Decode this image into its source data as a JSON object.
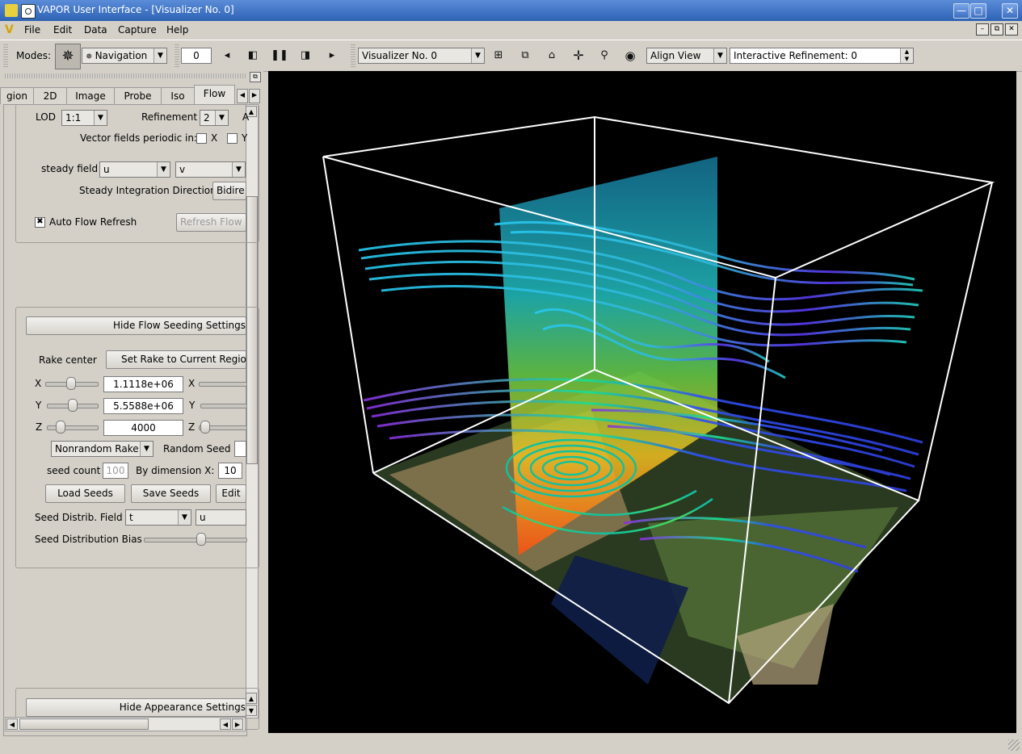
{
  "window": {
    "title": "VAPOR User Interface - [Visualizer No. 0]",
    "min_glyph": "—",
    "max_glyph": "□",
    "close_glyph": "✕"
  },
  "menu": {
    "items": [
      "File",
      "Edit",
      "Data",
      "Capture",
      "Help"
    ],
    "mdi_min": "–",
    "mdi_restore": "⧉",
    "mdi_close": "✕"
  },
  "toolbar": {
    "modes_label": "Modes:",
    "mode_value": "Navigation",
    "frame_value": "0",
    "visualizer_value": "Visualizer No. 0",
    "align_view_value": "Align View",
    "refinement_value": "Interactive Refinement: 0"
  },
  "tabs": [
    "gion",
    "2D",
    "Image",
    "Probe",
    "Iso",
    "Flow"
  ],
  "flow_panel": {
    "lod_label": "LOD",
    "lod_value": "1:1",
    "refinement_label": "Refinement",
    "refinement_value": "2",
    "refinement_trailing": "A",
    "periodic_label": "Vector fields periodic in:",
    "periodic_x": "X",
    "periodic_y": "Y",
    "steady_field_label": "steady field",
    "steady_field_1": "u",
    "steady_field_2": "v",
    "direction_label": "Steady Integration Direction",
    "direction_value": "Bidire",
    "auto_refresh_label": "Auto Flow Refresh",
    "auto_refresh_checked": true,
    "refresh_button": "Refresh  Flow"
  },
  "seeding": {
    "hide_button": "Hide Flow Seeding Settings",
    "rake_center_label": "Rake center",
    "set_rake_button": "Set Rake to Current Region",
    "x_label": "X",
    "y_label": "Y",
    "z_label": "Z",
    "x_value": "1.1118e+06",
    "y_value": "5.5588e+06",
    "z_value": "4000",
    "rake_type": "Nonrandom Rake",
    "random_seed_label": "Random Seed",
    "seed_count_label": "seed count",
    "seed_count_value": "100",
    "by_dimension_label": "By dimension  X:",
    "by_dimension_x": "10",
    "load_seeds": "Load Seeds",
    "save_seeds": "Save Seeds",
    "edit": "Edit",
    "distrib_field_label": "Seed Distrib. Field",
    "distrib_field_1": "t",
    "distrib_field_2": "u",
    "distrib_bias_label": "Seed Distribution Bias"
  },
  "appearance": {
    "hide_button": "Hide Appearance Settings"
  },
  "colors": {
    "title_bar": "#3a6fc4",
    "panel_bg": "#d4d0c8",
    "viewport_bg": "#000000"
  },
  "icons": [
    "vapor-logo-icon",
    "minimize-icon",
    "maximize-icon",
    "close-icon",
    "navigation-mode-icon",
    "step-back-icon",
    "play-back-icon",
    "pause-icon",
    "play-forward-icon",
    "step-forward-icon",
    "tile-icon",
    "cascade-icon",
    "home-icon",
    "view-all-icon",
    "zoom-icon",
    "eye-icon"
  ]
}
